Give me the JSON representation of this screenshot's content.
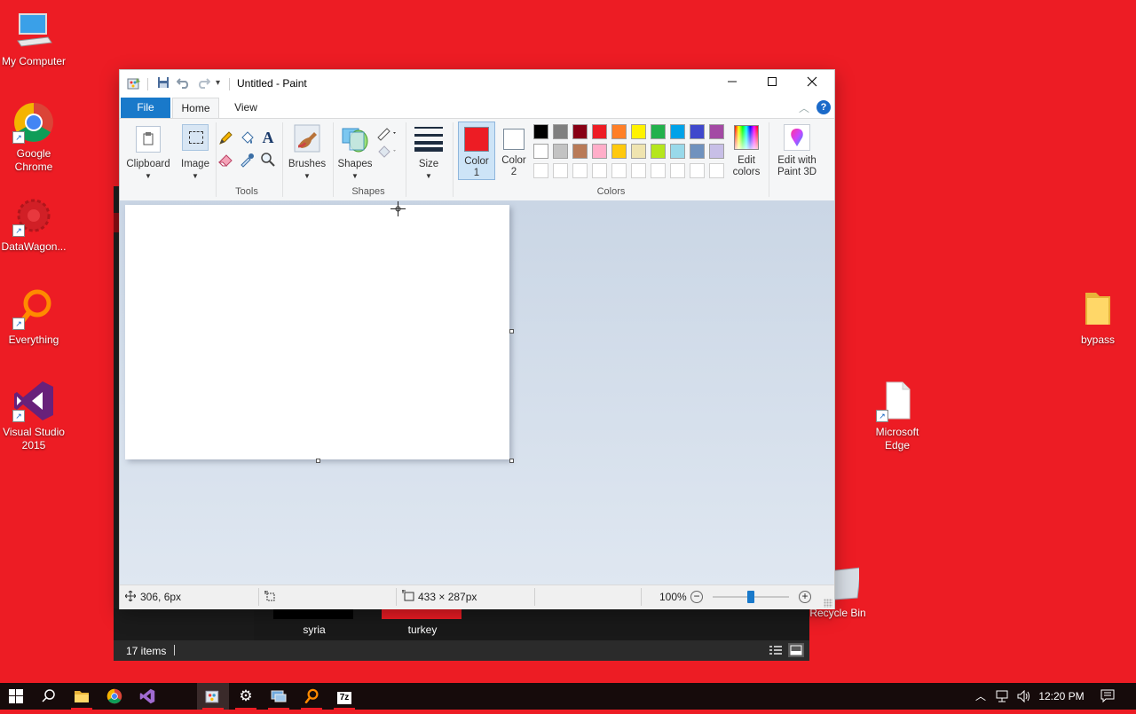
{
  "desktop": {
    "icons": [
      {
        "label": "My Computer",
        "icon": "computer-icon"
      },
      {
        "label": "Google Chrome",
        "icon": "chrome-icon"
      },
      {
        "label": "DataWagon...",
        "icon": "datawagon-icon"
      },
      {
        "label": "Everything",
        "icon": "everything-search-icon"
      },
      {
        "label": "Visual Studio 2015",
        "icon": "visual-studio-icon"
      },
      {
        "label": "bypass",
        "icon": "folder-icon"
      },
      {
        "label": "Microsoft Edge",
        "icon": "document-icon"
      },
      {
        "label": "Recycle Bin",
        "icon": "recycle-bin-icon"
      }
    ]
  },
  "explorer": {
    "items": [
      "syria",
      "turkey"
    ],
    "item_colors": [
      "#000000",
      "#ed1c24"
    ],
    "status": "17 items"
  },
  "paint": {
    "title": "Untitled - Paint",
    "tabs": {
      "file": "File",
      "home": "Home",
      "view": "View"
    },
    "groups": {
      "clipboard": "Clipboard",
      "image": "Image",
      "tools": "Tools",
      "brushes": "Brushes",
      "shapes": "Shapes",
      "shapes_group": "Shapes",
      "size": "Size",
      "color1_line1": "Color",
      "color1_line2": "1",
      "color2_line1": "Color",
      "color2_line2": "2",
      "colors": "Colors",
      "edit_colors_line1": "Edit",
      "edit_colors_line2": "colors",
      "paint3d_line1": "Edit with",
      "paint3d_line2": "Paint 3D"
    },
    "color1": "#ed1c24",
    "color2": "#ffffff",
    "palette": {
      "row1": [
        "#000000",
        "#7f7f7f",
        "#880015",
        "#ed1c24",
        "#ff7f27",
        "#fff200",
        "#22b14c",
        "#00a2e8",
        "#3f48cc",
        "#a349a4"
      ],
      "row2": [
        "#ffffff",
        "#c3c3c3",
        "#b97a57",
        "#ffaec9",
        "#ffc90e",
        "#efe4b0",
        "#b5e61d",
        "#99d9ea",
        "#7092be",
        "#c8bfe7"
      ],
      "row3": [
        "#ffffff",
        "#ffffff",
        "#ffffff",
        "#ffffff",
        "#ffffff",
        "#ffffff",
        "#ffffff",
        "#ffffff",
        "#ffffff",
        "#ffffff"
      ]
    },
    "status": {
      "cursor_pos": "306, 6px",
      "selection": "",
      "image_size": "433 × 287px",
      "zoom": "100%"
    },
    "zoom_fraction": 0.5
  },
  "taskbar": {
    "time": "12:20 PM"
  }
}
